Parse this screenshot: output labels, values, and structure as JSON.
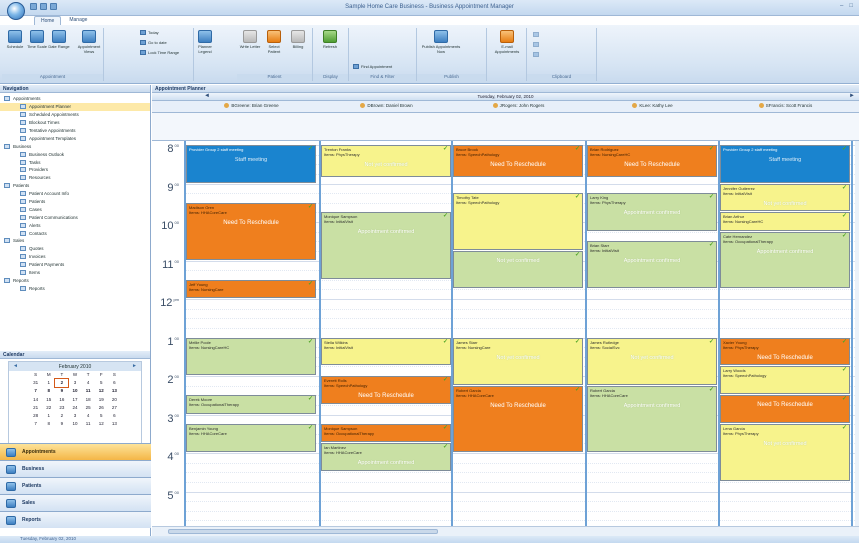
{
  "window": {
    "title": "Sample Home Care Business - Business Appointment Manager"
  },
  "tabs": [
    "Home",
    "Manage"
  ],
  "ribbon": {
    "groups": [
      {
        "label": "Appointment",
        "buttons": [
          "Schedule",
          "Time Scale",
          "Date Range",
          "Appointment Views"
        ],
        "small": [
          "Today",
          "Go to date",
          "Lock Time Range"
        ]
      },
      {
        "label": "Appointment",
        "buttons": [
          "Planner Legend"
        ]
      },
      {
        "label": "Patient",
        "buttons": [
          "Write Letter",
          "Select Patient",
          "Billing"
        ]
      },
      {
        "label": "Display",
        "buttons": [
          "Refresh"
        ]
      },
      {
        "label": "Find & Filter",
        "small": [
          "Find Appointment"
        ]
      },
      {
        "label": "Publish",
        "buttons": [
          "Publish Appointments Now"
        ]
      },
      {
        "label": "",
        "buttons": [
          "E-mail Appointments"
        ]
      },
      {
        "label": "Clipboard",
        "buttons": []
      }
    ]
  },
  "nav": {
    "header": "Navigation",
    "tree": [
      {
        "label": "Appointments",
        "level": 0
      },
      {
        "label": "Appointment Planner",
        "level": 1,
        "selected": true
      },
      {
        "label": "Scheduled Appointments",
        "level": 1
      },
      {
        "label": "Blockout Times",
        "level": 1
      },
      {
        "label": "Tentative Appointments",
        "level": 1
      },
      {
        "label": "Appointment Templates",
        "level": 1
      },
      {
        "label": "Business",
        "level": 0
      },
      {
        "label": "Business Outlook",
        "level": 1
      },
      {
        "label": "Tasks",
        "level": 1
      },
      {
        "label": "Providers",
        "level": 1
      },
      {
        "label": "Resources",
        "level": 1
      },
      {
        "label": "Patients",
        "level": 0
      },
      {
        "label": "Patient Account Info",
        "level": 1
      },
      {
        "label": "Patients",
        "level": 1
      },
      {
        "label": "Cases",
        "level": 1
      },
      {
        "label": "Patient Communications",
        "level": 1
      },
      {
        "label": "Alerts",
        "level": 1
      },
      {
        "label": "Contacts",
        "level": 1
      },
      {
        "label": "Sales",
        "level": 0
      },
      {
        "label": "Quotes",
        "level": 1
      },
      {
        "label": "Invoices",
        "level": 1
      },
      {
        "label": "Patient Payments",
        "level": 1
      },
      {
        "label": "Items",
        "level": 1
      },
      {
        "label": "Reports",
        "level": 0
      },
      {
        "label": "Reports",
        "level": 1
      }
    ],
    "calendar_header": "Calendar",
    "calendar": {
      "month": "February 2010",
      "dow": [
        "S",
        "M",
        "T",
        "W",
        "T",
        "F",
        "S"
      ],
      "weeks": [
        [
          "31",
          "1",
          "2",
          "3",
          "4",
          "5",
          "6"
        ],
        [
          "7",
          "8",
          "9",
          "10",
          "11",
          "12",
          "13"
        ],
        [
          "14",
          "15",
          "16",
          "17",
          "18",
          "19",
          "20"
        ],
        [
          "21",
          "22",
          "23",
          "24",
          "25",
          "26",
          "27"
        ],
        [
          "28",
          "1",
          "2",
          "3",
          "4",
          "5",
          "6"
        ],
        [
          "7",
          "8",
          "9",
          "10",
          "11",
          "12",
          "13"
        ]
      ],
      "today": "2"
    },
    "workspaces": [
      "Appointments",
      "Business",
      "Patients",
      "Sales",
      "Reports"
    ]
  },
  "status": "Tuesday, February 02, 2010",
  "planner": {
    "header": "Appointment Planner",
    "date": "Tuesday, February 02, 2010",
    "resources": [
      "BGreene: Brian Greene",
      "DBrown: Daniel Brown",
      "JRogers: John Rogers",
      "KLee: Kathy Lee",
      "SFrancis: Scott Francis"
    ],
    "hours": [
      {
        "h": "8",
        "m": "00"
      },
      {
        "h": "9",
        "m": "00"
      },
      {
        "h": "10",
        "m": "00"
      },
      {
        "h": "11",
        "m": "00"
      },
      {
        "h": "12",
        "m": "pm"
      },
      {
        "h": "1",
        "m": "00"
      },
      {
        "h": "2",
        "m": "00"
      },
      {
        "h": "3",
        "m": "00"
      },
      {
        "h": "4",
        "m": "00"
      },
      {
        "h": "5",
        "m": "00"
      }
    ],
    "appointments": [
      {
        "col": 0,
        "start": 8.0,
        "end": 9.0,
        "color": "blue",
        "name": "Provider Group 2 staff meeting",
        "service": "",
        "status": "Staff meeting"
      },
      {
        "col": 0,
        "start": 9.5,
        "end": 11.0,
        "color": "orange",
        "name": "Madison Oren",
        "service": "Items: HHACoreCare",
        "status": "Need To Reschedule"
      },
      {
        "col": 0,
        "start": 11.5,
        "end": 12.0,
        "color": "orange",
        "name": "Jeff Young",
        "service": "Items: NursingCare",
        "status": ""
      },
      {
        "col": 0,
        "start": 13.0,
        "end": 14.0,
        "color": "green",
        "name": "Mellie Poole",
        "service": "Items: NursingCareHC",
        "status": ""
      },
      {
        "col": 0,
        "start": 14.5,
        "end": 15.0,
        "color": "green",
        "name": "Derek Moore",
        "service": "Items: OccupationalTherapy",
        "status": ""
      },
      {
        "col": 0,
        "start": 15.25,
        "end": 16.0,
        "color": "green",
        "name": "Benjamin Young",
        "service": "Items: HHACoreCare",
        "status": ""
      },
      {
        "col": 1,
        "start": 8.0,
        "end": 8.85,
        "color": "yellow",
        "name": "Trenton Franks",
        "service": "Items: PhysTherapy",
        "status": "Not yet confirmed"
      },
      {
        "col": 1,
        "start": 9.75,
        "end": 11.5,
        "color": "green",
        "name": "Monique Sampson",
        "service": "Items: InitialVisit",
        "status": "Appointment confirmed"
      },
      {
        "col": 1,
        "start": 13.0,
        "end": 13.75,
        "color": "yellow",
        "name": "Stella Wilkins",
        "service": "Items: InitialVisit",
        "status": ""
      },
      {
        "col": 1,
        "start": 14.0,
        "end": 14.75,
        "color": "orange",
        "name": "Everett Rolls",
        "service": "Items: SpeechPathology",
        "status": "Need To Reschedule"
      },
      {
        "col": 1,
        "start": 15.25,
        "end": 15.75,
        "color": "orange",
        "name": "Monique Sampson",
        "service": "Items: OccupationalTherapy",
        "status": ""
      },
      {
        "col": 1,
        "start": 15.75,
        "end": 16.5,
        "color": "green",
        "name": "Ian Martinez",
        "service": "Items: HHACoreCare",
        "status": "Appointment confirmed"
      },
      {
        "col": 2,
        "start": 8.0,
        "end": 8.85,
        "color": "orange",
        "name": "Bruce Brook",
        "service": "Items: SpeechPathology",
        "status": "Need To Reschedule"
      },
      {
        "col": 2,
        "start": 9.25,
        "end": 10.75,
        "color": "yellow",
        "name": "Timothy Tate",
        "service": "Items: SpeechPathology",
        "status": ""
      },
      {
        "col": 2,
        "start": 10.75,
        "end": 11.75,
        "color": "green",
        "name": "",
        "service": "",
        "status": "Not yet confirmed"
      },
      {
        "col": 2,
        "start": 13.0,
        "end": 14.25,
        "color": "yellow",
        "name": "James Starr",
        "service": "Items: NursingCare",
        "status": "Not yet confirmed"
      },
      {
        "col": 2,
        "start": 14.25,
        "end": 16.0,
        "color": "orange",
        "name": "Robert Garcia",
        "service": "Items: HHACoreCare",
        "status": "Need To Reschedule"
      },
      {
        "col": 3,
        "start": 8.0,
        "end": 8.85,
        "color": "orange",
        "name": "Brian Rodriguez",
        "service": "Items: NursingCareHC",
        "status": "Need To Reschedule"
      },
      {
        "col": 3,
        "start": 9.25,
        "end": 10.25,
        "color": "green",
        "name": "Larry King",
        "service": "Items: PhysTherapy",
        "status": "Appointment confirmed"
      },
      {
        "col": 3,
        "start": 10.5,
        "end": 11.75,
        "color": "green",
        "name": "Brian Starr",
        "service": "Items: InitialVisit",
        "status": "Appointment confirmed"
      },
      {
        "col": 3,
        "start": 13.0,
        "end": 14.25,
        "color": "yellow",
        "name": "James Rutledge",
        "service": "Items: SocialSvc",
        "status": "Not yet confirmed"
      },
      {
        "col": 3,
        "start": 14.25,
        "end": 16.0,
        "color": "green",
        "name": "Robert Garcia",
        "service": "Items: HHACoreCare",
        "status": "Appointment confirmed"
      },
      {
        "col": 4,
        "start": 8.0,
        "end": 9.0,
        "color": "blue",
        "name": "Provider Group 2 staff meeting",
        "service": "",
        "status": "Staff meeting"
      },
      {
        "col": 4,
        "start": 9.0,
        "end": 9.75,
        "color": "yellow",
        "name": "Jennifer Gutierrez",
        "service": "Items: InitialVisit",
        "status": "Not yet confirmed"
      },
      {
        "col": 4,
        "start": 9.75,
        "end": 10.25,
        "color": "yellow",
        "name": "Brian Arthur",
        "service": "Items: NursingCareHC",
        "status": ""
      },
      {
        "col": 4,
        "start": 10.25,
        "end": 11.75,
        "color": "green",
        "name": "Cate Hernandez",
        "service": "Items: OccupationalTherapy",
        "status": "Appointment confirmed"
      },
      {
        "col": 4,
        "start": 13.0,
        "end": 13.75,
        "color": "orange",
        "name": "Xavier Young",
        "service": "Items: PhysTherapy",
        "status": "Need To Reschedule"
      },
      {
        "col": 4,
        "start": 13.75,
        "end": 14.5,
        "color": "yellow",
        "name": "Larry Woods",
        "service": "Items: SpeechPathology",
        "status": ""
      },
      {
        "col": 4,
        "start": 14.5,
        "end": 15.25,
        "color": "orange",
        "name": "",
        "service": "",
        "status": "Need To Reschedule"
      },
      {
        "col": 4,
        "start": 15.25,
        "end": 16.75,
        "color": "yellow",
        "name": "Lena Garcia",
        "service": "Items: PhysTherapy",
        "status": "Not yet confirmed"
      }
    ]
  }
}
